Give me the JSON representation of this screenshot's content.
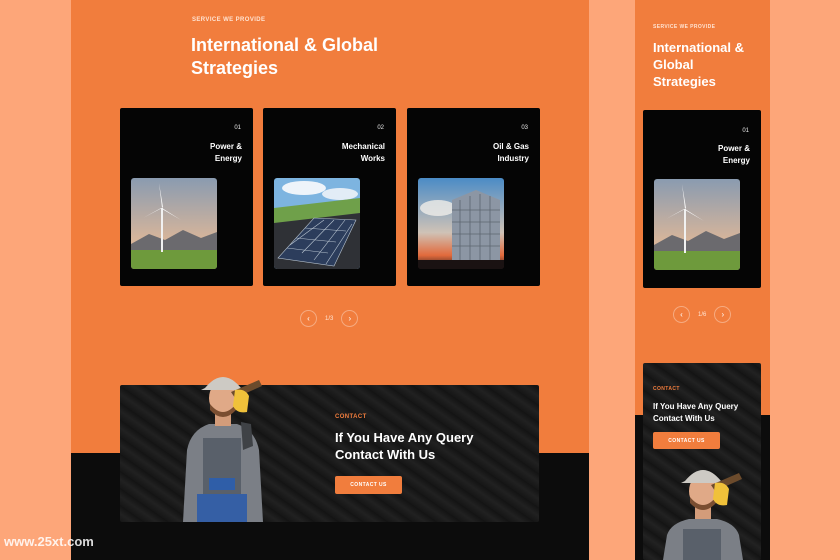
{
  "desktop": {
    "eyebrow": "SERVICE WE PROVIDE",
    "title_line1": "International & Global",
    "title_line2": "Strategies",
    "cards": [
      {
        "num": "01",
        "name_line1": "Power &",
        "name_line2": "Energy",
        "image": "wind-turbine-photo"
      },
      {
        "num": "02",
        "name_line1": "Mechanical",
        "name_line2": "Works",
        "image": "solar-panels-photo"
      },
      {
        "num": "03",
        "name_line1": "Oil & Gas",
        "name_line2": "Industry",
        "image": "storage-silo-photo"
      }
    ],
    "pager": {
      "prev": "‹",
      "count": "1/3",
      "next": "›"
    },
    "contact": {
      "eyebrow": "CONTACT",
      "title_line1": "If You Have Any Query",
      "title_line2": "Contact With Us",
      "button": "CONTACT US"
    }
  },
  "mobile": {
    "eyebrow": "SERVICE WE PROVIDE",
    "title_line1": "International &",
    "title_line2": "Global",
    "title_line3": "Strategies",
    "card": {
      "num": "01",
      "name_line1": "Power &",
      "name_line2": "Energy"
    },
    "pager": {
      "prev": "‹",
      "count": "1/6",
      "next": "›"
    },
    "contact": {
      "eyebrow": "CONTACT",
      "title_line1": "If You Have Any Query",
      "title_line2": "Contact With Us",
      "button": "CONTACT US"
    }
  },
  "watermark": "www.25xt.com",
  "colors": {
    "accent": "#f17d3d",
    "background": "#fda679",
    "card": "#050505",
    "dark": "#0c0c0c"
  }
}
